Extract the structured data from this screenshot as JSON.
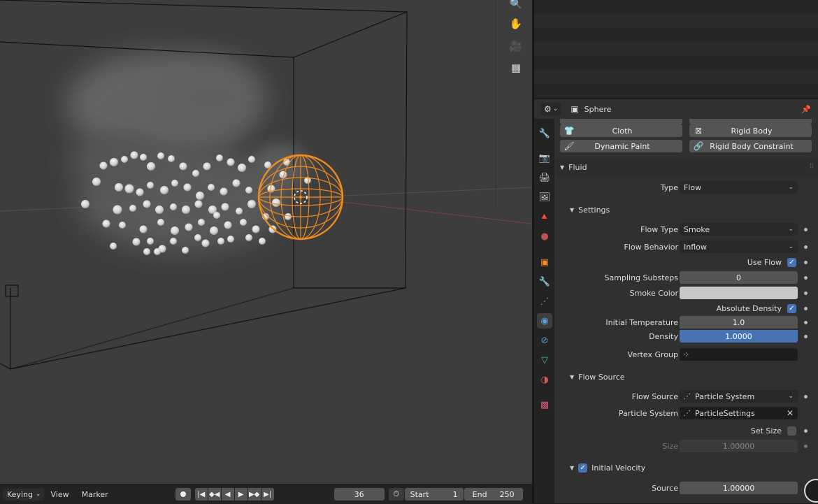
{
  "viewport": {
    "nav_icons": [
      "zoom-icon",
      "hand-pan-icon",
      "camera-icon",
      "grid-perspective-icon"
    ]
  },
  "timeline": {
    "keying_label": "Keying",
    "view_label": "View",
    "marker_label": "Marker",
    "current_frame": "36",
    "start_label": "Start",
    "start_value": "1",
    "end_label": "End",
    "end_value": "250"
  },
  "properties": {
    "header": {
      "object_name": "Sphere"
    },
    "physics_buttons": {
      "cloth": "Cloth",
      "rigid_body": "Rigid Body",
      "dynamic_paint": "Dynamic Paint",
      "rigid_body_constraint": "Rigid Body Constraint"
    },
    "fluid": {
      "panel_title": "Fluid",
      "type_label": "Type",
      "type_value": "Flow",
      "settings": {
        "title": "Settings",
        "flow_type_label": "Flow Type",
        "flow_type_value": "Smoke",
        "flow_behavior_label": "Flow Behavior",
        "flow_behavior_value": "Inflow",
        "use_flow_label": "Use Flow",
        "use_flow_checked": true,
        "sampling_substeps_label": "Sampling Substeps",
        "sampling_substeps_value": "0",
        "smoke_color_label": "Smoke Color",
        "smoke_color": "#c8c8c8",
        "absolute_density_label": "Absolute Density",
        "absolute_density_checked": true,
        "initial_temperature_label": "Initial Temperature",
        "initial_temperature_value": "1.0",
        "density_label": "Density",
        "density_value": "1.0000",
        "vertex_group_label": "Vertex Group"
      },
      "flow_source": {
        "title": "Flow Source",
        "flow_source_label": "Flow Source",
        "flow_source_value": "Particle System",
        "particle_system_label": "Particle System",
        "particle_system_value": "ParticleSettings",
        "set_size_label": "Set Size",
        "set_size_checked": false,
        "size_label": "Size",
        "size_value": "1.00000"
      },
      "initial_velocity": {
        "title": "Initial Velocity",
        "enabled": true,
        "source_label": "Source",
        "source_value": "1.00000"
      }
    }
  },
  "colors": {
    "accent_blue": "#4772b3",
    "selection_orange": "#f08c1e",
    "viewport_bg": "#3d3d3d",
    "panel_bg": "#303030"
  }
}
